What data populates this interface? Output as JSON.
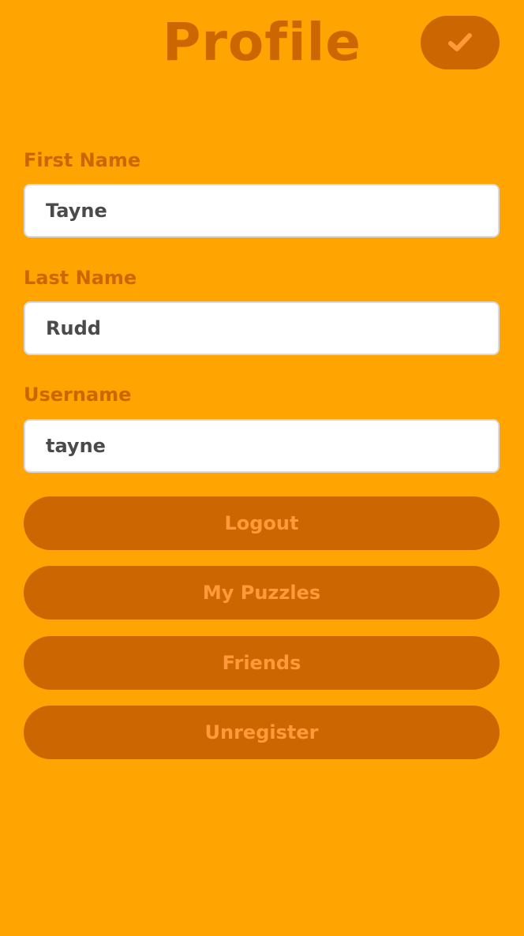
{
  "header": {
    "title": "Profile",
    "confirm_icon": "checkmark-icon"
  },
  "form": {
    "first_name": {
      "label": "First Name",
      "value": "Tayne"
    },
    "last_name": {
      "label": "Last Name",
      "value": "Rudd"
    },
    "username": {
      "label": "Username",
      "value": "tayne"
    }
  },
  "actions": {
    "logout": "Logout",
    "my_puzzles": "My Puzzles",
    "friends": "Friends",
    "unregister": "Unregister"
  },
  "colors": {
    "background": "#ffa400",
    "accent": "#cc6600",
    "button_text": "#ff9a3a",
    "input_text": "#4a4a4a"
  }
}
